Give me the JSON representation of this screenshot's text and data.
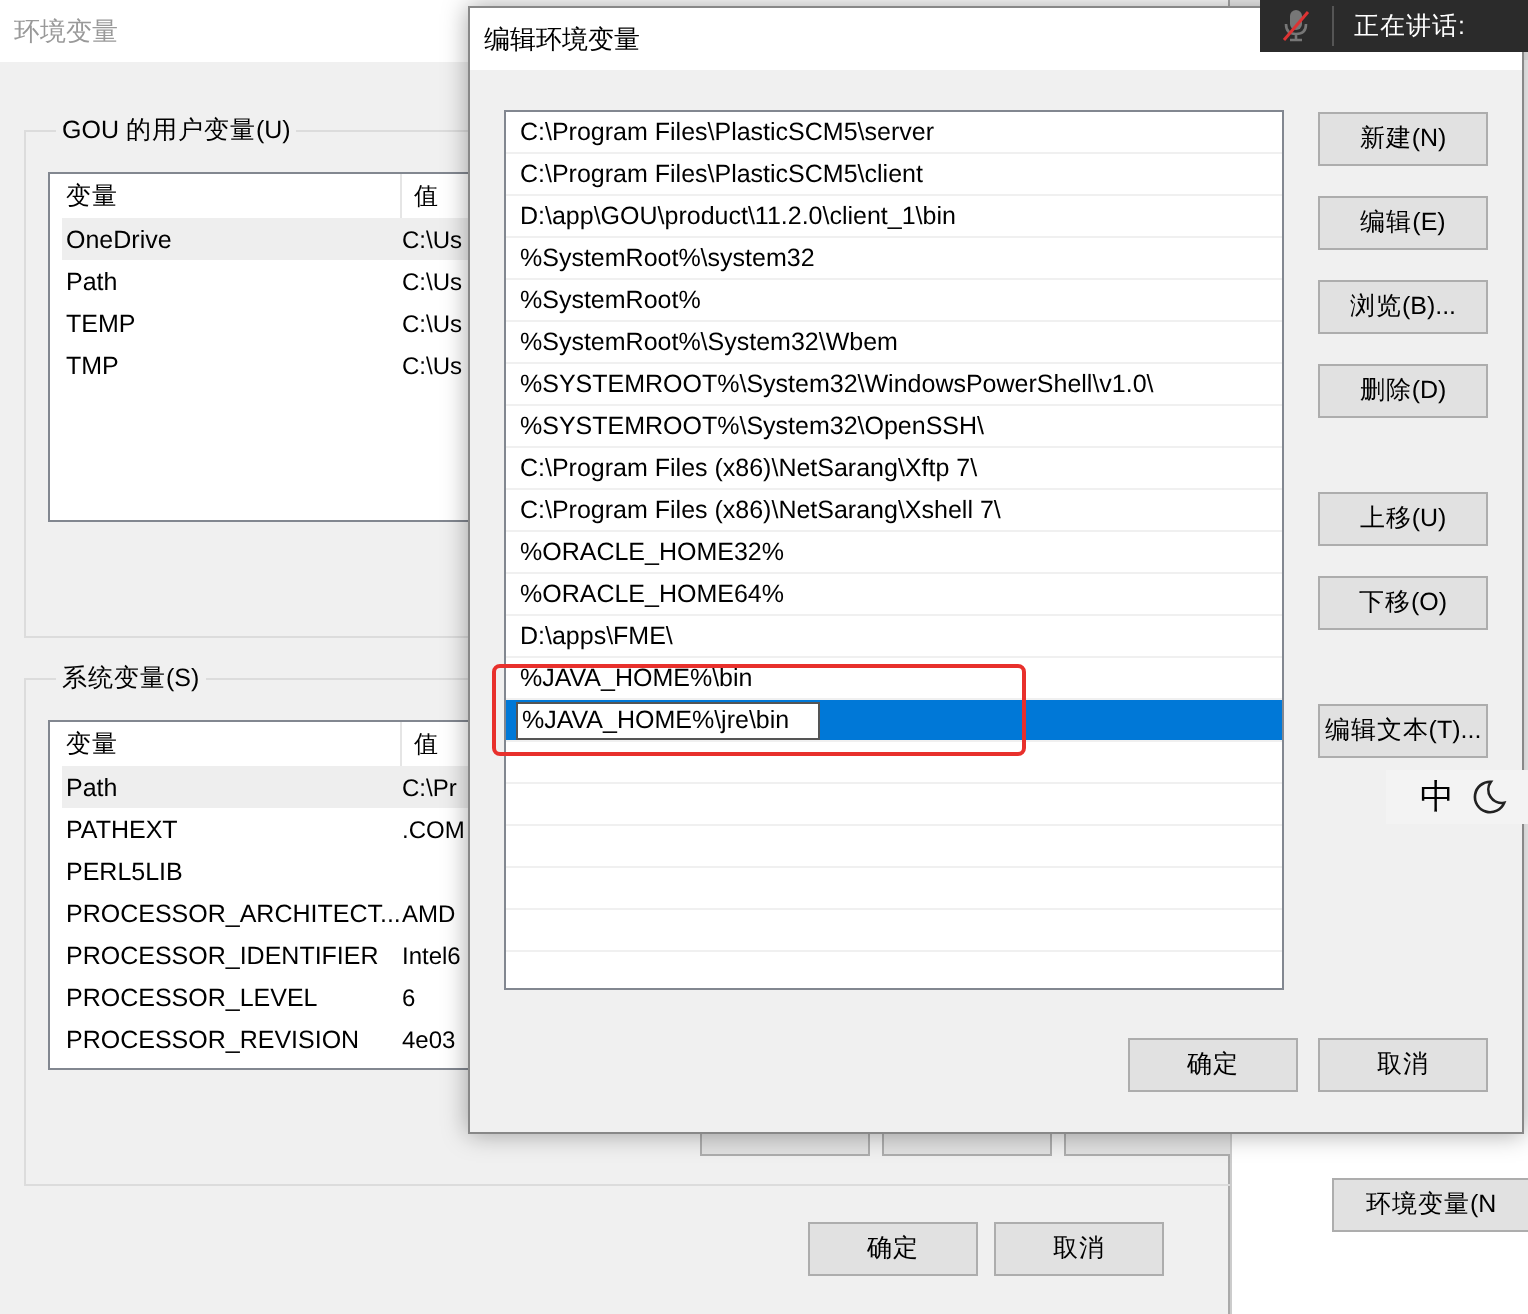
{
  "background_window": {
    "title": "环境变量",
    "user_group": {
      "label": "GOU 的用户变量(U)",
      "columns": [
        "变量",
        "值"
      ],
      "rows": [
        {
          "name": "OneDrive",
          "value": "C:\\Us",
          "selected": true
        },
        {
          "name": "Path",
          "value": "C:\\Us",
          "selected": false
        },
        {
          "name": "TEMP",
          "value": "C:\\Us",
          "selected": false
        },
        {
          "name": "TMP",
          "value": "C:\\Us",
          "selected": false
        }
      ]
    },
    "system_group": {
      "label": "系统变量(S)",
      "columns": [
        "变量",
        "值"
      ],
      "rows": [
        {
          "name": "Path",
          "value": "C:\\Pr",
          "selected": true
        },
        {
          "name": "PATHEXT",
          "value": ".COM",
          "selected": false
        },
        {
          "name": "PERL5LIB",
          "selected": false
        },
        {
          "name": "PROCESSOR_ARCHITECT...",
          "value": "AMD",
          "selected": false
        },
        {
          "name": "PROCESSOR_IDENTIFIER",
          "value": "Intel6",
          "selected": false
        },
        {
          "name": "PROCESSOR_LEVEL",
          "value": "6",
          "selected": false
        },
        {
          "name": "PROCESSOR_REVISION",
          "value": "4e03",
          "selected": false
        }
      ]
    },
    "footer_buttons": [
      "确定",
      "取消"
    ]
  },
  "side_window": {
    "button": "环境变量(N"
  },
  "dialog": {
    "title": "编辑环境变量",
    "entries": [
      {
        "text": "C:\\Program Files\\PlasticSCM5\\server",
        "selected": false,
        "editing": false
      },
      {
        "text": "C:\\Program Files\\PlasticSCM5\\client",
        "selected": false,
        "editing": false
      },
      {
        "text": "D:\\app\\GOU\\product\\11.2.0\\client_1\\bin",
        "selected": false,
        "editing": false
      },
      {
        "text": "%SystemRoot%\\system32",
        "selected": false,
        "editing": false
      },
      {
        "text": "%SystemRoot%",
        "selected": false,
        "editing": false
      },
      {
        "text": "%SystemRoot%\\System32\\Wbem",
        "selected": false,
        "editing": false
      },
      {
        "text": "%SYSTEMROOT%\\System32\\WindowsPowerShell\\v1.0\\",
        "selected": false,
        "editing": false
      },
      {
        "text": "%SYSTEMROOT%\\System32\\OpenSSH\\",
        "selected": false,
        "editing": false
      },
      {
        "text": "C:\\Program Files (x86)\\NetSarang\\Xftp 7\\",
        "selected": false,
        "editing": false
      },
      {
        "text": "C:\\Program Files (x86)\\NetSarang\\Xshell 7\\",
        "selected": false,
        "editing": false
      },
      {
        "text": "%ORACLE_HOME32%",
        "selected": false,
        "editing": false
      },
      {
        "text": "%ORACLE_HOME64%",
        "selected": false,
        "editing": false
      },
      {
        "text": "D:\\apps\\FME\\",
        "selected": false,
        "editing": false
      },
      {
        "text": "%JAVA_HOME%\\bin",
        "selected": false,
        "editing": false
      },
      {
        "text": "%JAVA_HOME%\\jre\\bin",
        "selected": true,
        "editing": true
      }
    ],
    "button_groups": [
      [
        "新建(N)",
        "编辑(E)",
        "浏览(B)...",
        "删除(D)"
      ],
      [
        "上移(U)",
        "下移(O)"
      ],
      [
        "编辑文本(T)..."
      ]
    ],
    "footer_buttons": [
      "确定",
      "取消"
    ]
  },
  "meeting_bar": {
    "muted": true,
    "status": "正在讲话:"
  },
  "ime": {
    "mode": "中"
  }
}
